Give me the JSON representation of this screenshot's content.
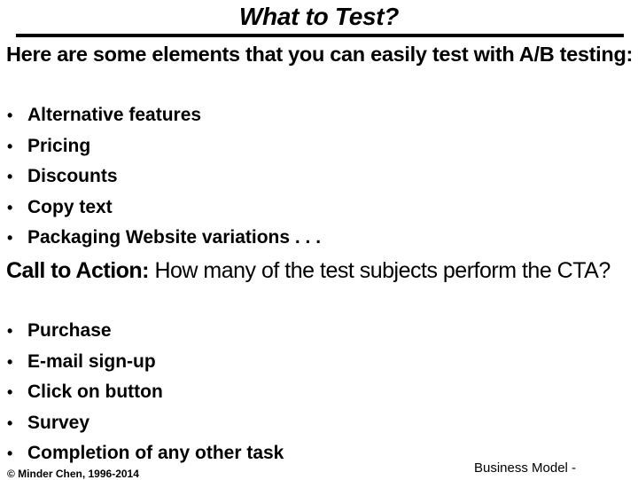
{
  "slide": {
    "title": "What to Test?",
    "intro": "Here are some elements that you can easily test with A/B testing:",
    "test_elements": [
      "Alternative features",
      "Pricing",
      "Discounts",
      "Copy text",
      "Packaging Website variations . . ."
    ],
    "cta": {
      "label": "Call to Action:",
      "question": " How many of the test subjects perform the CTA?"
    },
    "cta_items": [
      "Purchase",
      "E-mail sign-up",
      "Click on button",
      "Survey",
      "Completion of any other task"
    ],
    "bullet_glyph": "•",
    "footer": {
      "copyright": "© Minder Chen, 1996-2014",
      "section": "Business Model -"
    }
  }
}
